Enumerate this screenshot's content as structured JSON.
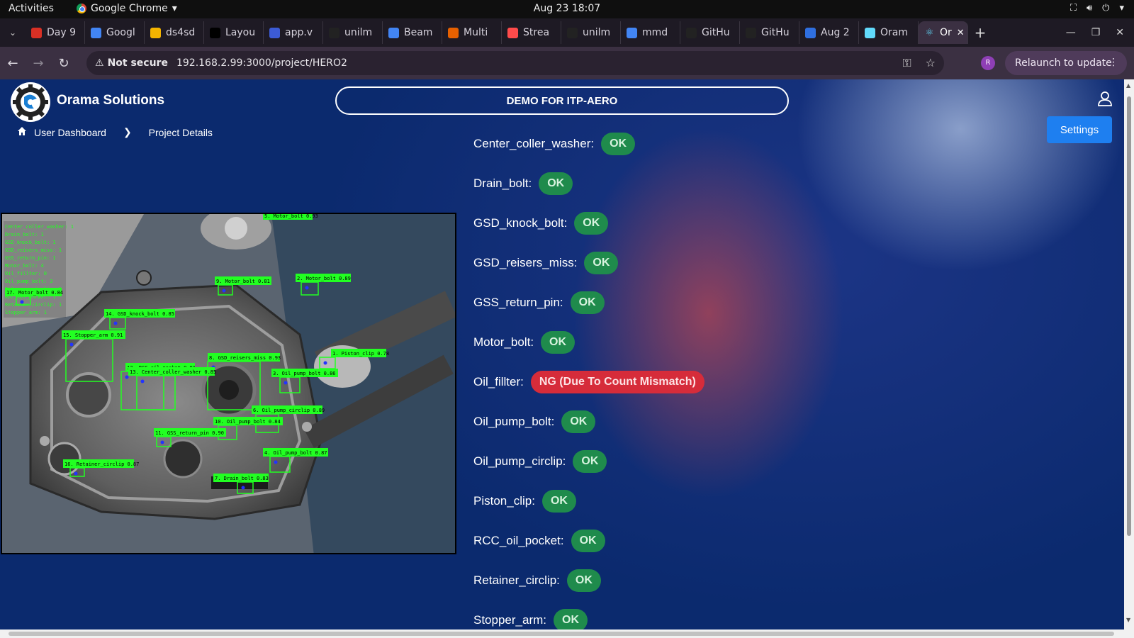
{
  "system_bar": {
    "activities": "Activities",
    "app_name": "Google Chrome",
    "clock": "Aug 23  18:07"
  },
  "tabs": [
    {
      "label": "Day 9",
      "icon": "gmail-icon",
      "color": "#d93025"
    },
    {
      "label": "Googl",
      "icon": "google-icon",
      "color": "#4285f4"
    },
    {
      "label": "ds4sd",
      "icon": "hugging-face-icon",
      "color": "#f4b400"
    },
    {
      "label": "Layou",
      "icon": "medium-icon",
      "color": "#000000"
    },
    {
      "label": "app.v",
      "icon": "doc-icon",
      "color": "#3c5bd6"
    },
    {
      "label": "unilm",
      "icon": "github-icon",
      "color": "#222222"
    },
    {
      "label": "Beam",
      "icon": "google-icon",
      "color": "#4285f4"
    },
    {
      "label": "Multi",
      "icon": "firefox-icon",
      "color": "#e66000"
    },
    {
      "label": "Strea",
      "icon": "streamlit-icon",
      "color": "#ff4b4b"
    },
    {
      "label": "unilm",
      "icon": "github-icon",
      "color": "#222222"
    },
    {
      "label": "mmd",
      "icon": "google-icon",
      "color": "#4285f4"
    },
    {
      "label": "GitHu",
      "icon": "github-icon",
      "color": "#222222"
    },
    {
      "label": "GitHu",
      "icon": "github-icon",
      "color": "#222222"
    },
    {
      "label": "Aug 2",
      "icon": "sparkle-icon",
      "color": "#2f6fe0"
    },
    {
      "label": "Oram",
      "icon": "react-icon",
      "color": "#61dafb"
    }
  ],
  "active_tab": {
    "label": "Or",
    "icon": "react-icon"
  },
  "address_bar": {
    "security": "Not secure",
    "url": "192.168.2.99:3000/project/HERO2",
    "profile_initial": "R",
    "relaunch": "Relaunch to update"
  },
  "app": {
    "brand": "Orama Solutions",
    "banner": "DEMO FOR ITP-AERO",
    "settings": "Settings",
    "breadcrumb": {
      "home": "User Dashboard",
      "current": "Project Details"
    }
  },
  "results": [
    {
      "label": "Center_coller_washer:",
      "status": "OK",
      "state": "ok"
    },
    {
      "label": "Drain_bolt:",
      "status": "OK",
      "state": "ok"
    },
    {
      "label": "GSD_knock_bolt:",
      "status": "OK",
      "state": "ok"
    },
    {
      "label": "GSD_reisers_miss:",
      "status": "OK",
      "state": "ok"
    },
    {
      "label": "GSS_return_pin:",
      "status": "OK",
      "state": "ok"
    },
    {
      "label": "Motor_bolt:",
      "status": "OK",
      "state": "ok"
    },
    {
      "label": "Oil_fillter:",
      "status": "NG (Due To Count Mismatch)",
      "state": "ng"
    },
    {
      "label": "Oil_pump_bolt:",
      "status": "OK",
      "state": "ok"
    },
    {
      "label": "Oil_pump_circlip:",
      "status": "OK",
      "state": "ok"
    },
    {
      "label": "Piston_clip:",
      "status": "OK",
      "state": "ok"
    },
    {
      "label": "RCC_oil_pocket:",
      "status": "OK",
      "state": "ok"
    },
    {
      "label": "Retainer_circlip:",
      "status": "OK",
      "state": "ok"
    },
    {
      "label": "Stopper_arm:",
      "status": "OK",
      "state": "ok"
    }
  ],
  "detection_image": {
    "summary": [
      "Center_coller_washer: 1",
      "Drain_bolt: 1",
      "GSD_knock_bolt: 1",
      "GSD_reisers_miss: 1",
      "GSS_return_pin: 1",
      "Motor_bolt: 4",
      "Oil_fillter: 0",
      "Oil_pump_bolt: 3",
      "Oil_pump_circlip: 1",
      "RCC_oil_pocket: 1",
      "Retainer_circlip: 1",
      "Stopper_arm: 1"
    ],
    "boxes": [
      {
        "label": "5. Motor_bolt 0.93"
      },
      {
        "label": "9. Motor_bolt 0.81"
      },
      {
        "label": "2. Motor_bolt 0.89"
      },
      {
        "label": "17. Motor_bolt 0.84"
      },
      {
        "label": "14. GSD_knock_bolt 0.85"
      },
      {
        "label": "15. Stopper_arm 0.91"
      },
      {
        "label": "1. Piston_clip 0.78"
      },
      {
        "label": "8. GSD_reisers_miss 0.93"
      },
      {
        "label": "12. RCC_oil_pocket 0.91"
      },
      {
        "label": "13. Center_coller_washer 0.85"
      },
      {
        "label": "3. Oil_pump_bolt 0.86"
      },
      {
        "label": "6. Oil_pump_circlip 0.89"
      },
      {
        "label": "10. Oil_pump_bolt 0.84"
      },
      {
        "label": "11. GSS_return_pin 0.90"
      },
      {
        "label": "4. Oil_pump_bolt 0.87"
      },
      {
        "label": "16. Retainer_circlip 0.87"
      },
      {
        "label": "7. Drain_bolt 0.83"
      }
    ]
  },
  "colors": {
    "ok": "#1f8b4c",
    "ng": "#d62c3a",
    "accent": "#1e7ff0",
    "page_bg": "#0b2a6e",
    "detection": "#22ff22"
  }
}
